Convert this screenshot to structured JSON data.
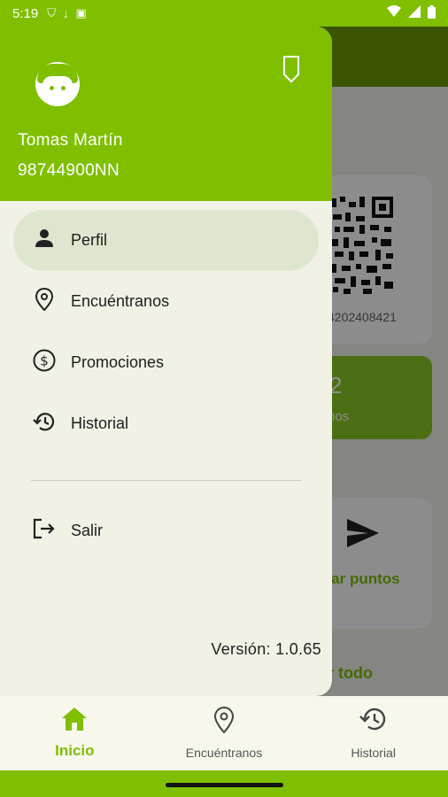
{
  "status_bar": {
    "time": "5:19",
    "icons": [
      "shield-icon",
      "usb-icon",
      "app-icon"
    ],
    "right_icons": [
      "wifi-icon",
      "signal-icon",
      "battery-icon"
    ]
  },
  "background": {
    "qr_code_text": "4202408421",
    "points_number": "2",
    "points_label": "nos",
    "send_points_label": "viar puntos",
    "see_all_label": "er todo"
  },
  "drawer": {
    "user_name": "Tomas Martín",
    "user_id": "98744900NN",
    "menu": [
      {
        "label": "Perfil",
        "icon": "person-icon",
        "active": true
      },
      {
        "label": "Encuéntranos",
        "icon": "location-pin-icon",
        "active": false
      },
      {
        "label": "Promociones",
        "icon": "dollar-circle-icon",
        "active": false
      },
      {
        "label": "Historial",
        "icon": "history-icon",
        "active": false
      }
    ],
    "logout_label": "Salir",
    "version": "Versión: 1.0.65"
  },
  "bottom_nav": [
    {
      "label": "Inicio",
      "icon": "home-icon",
      "active": true
    },
    {
      "label": "Encuéntranos",
      "icon": "location-pin-icon",
      "active": false
    },
    {
      "label": "Historial",
      "icon": "history-icon",
      "active": false
    }
  ],
  "colors": {
    "brand": "#7fbf00",
    "drawer_bg": "#f1f1e6",
    "active_item_bg": "#dfe6cf"
  }
}
